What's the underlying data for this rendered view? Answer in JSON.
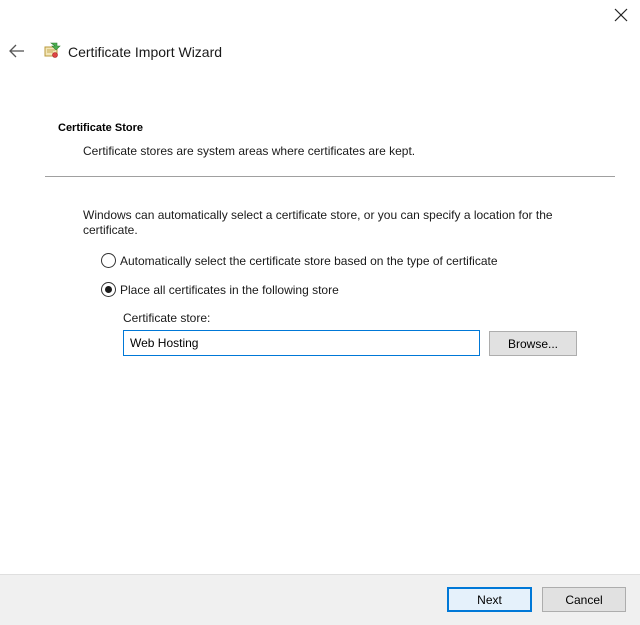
{
  "window": {
    "close_icon": "close-icon",
    "back_icon": "arrow-left-icon",
    "wizard_icon": "certificate-icon",
    "title": "Certificate Import Wizard"
  },
  "section": {
    "title": "Certificate Store",
    "description": "Certificate stores are system areas where certificates are kept."
  },
  "intro": "Windows can automatically select a certificate store, or you can specify a location for the certificate.",
  "options": [
    {
      "label": "Automatically select the certificate store based on the type of certificate",
      "selected": false
    },
    {
      "label": "Place all certificates in the following store",
      "selected": true
    }
  ],
  "store": {
    "label": "Certificate store:",
    "value": "Web Hosting",
    "browse_label": "Browse..."
  },
  "footer": {
    "next_label": "Next",
    "cancel_label": "Cancel"
  },
  "colors": {
    "accent": "#0078d7",
    "footer_bg": "#f0f0f0",
    "button_bg": "#e1e1e1"
  }
}
